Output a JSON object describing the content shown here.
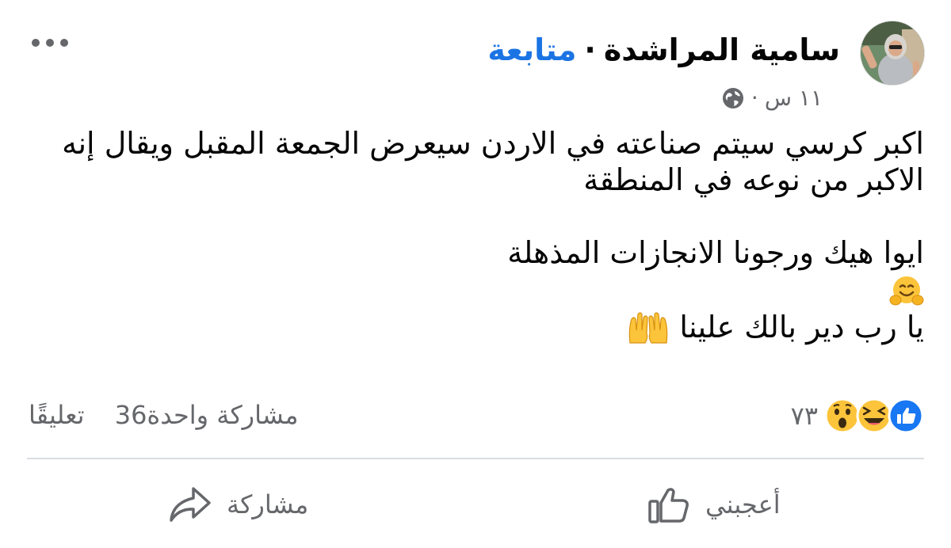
{
  "author": {
    "name": "سامية المراشدة",
    "separator": "·",
    "follow_label": "متابعة"
  },
  "meta": {
    "time": "١١ س",
    "separator": "·",
    "privacy_icon": "globe-icon"
  },
  "post": {
    "line1": "اكبر كرسي سيتم صناعته في الاردن سيعرض الجمعة المقبل ويقال إنه",
    "line2": "الاكبر من نوعه في المنطقة",
    "line3": "ايوا هيك ورجونا الانجازات المذهلة",
    "line4": "يا رب دير بالك علينا",
    "emoji_hug": "hugging-face-icon",
    "emoji_hands": "raising-hands-icon"
  },
  "reactions": {
    "count": "٧٣",
    "icons": [
      "like-icon",
      "laugh-icon",
      "wow-icon"
    ]
  },
  "stats": {
    "comments": "36 تعليقًا",
    "shares": "مشاركة واحدة"
  },
  "actions": {
    "like_label": "أعجبني",
    "share_label": "مشاركة"
  },
  "colors": {
    "link": "#1b74e4",
    "secondary_text": "#65676b",
    "like_blue": "#1877f2",
    "emoji_yellow": "#fcc43a"
  }
}
